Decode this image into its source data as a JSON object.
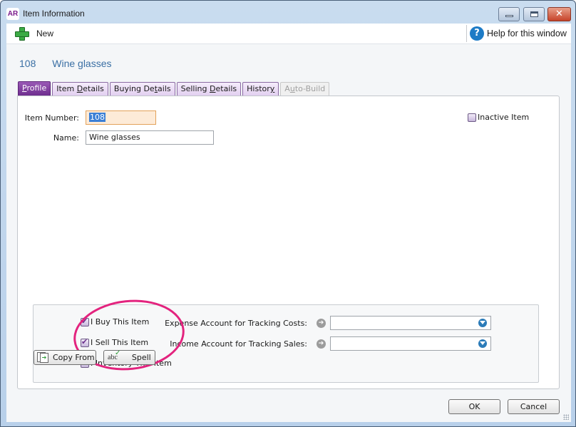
{
  "window": {
    "app_badge": "AR",
    "title": "Item Information"
  },
  "toolbar": {
    "new_label": "New",
    "help_label": "Help for this window"
  },
  "heading": {
    "item_number": "108",
    "item_name": "Wine glasses"
  },
  "tabs": [
    {
      "pre": "",
      "ul": "P",
      "post": "rofile",
      "active": true,
      "disabled": false
    },
    {
      "pre": "Item ",
      "ul": "D",
      "post": "etails",
      "active": false,
      "disabled": false
    },
    {
      "pre": "Buying De",
      "ul": "t",
      "post": "ails",
      "active": false,
      "disabled": false
    },
    {
      "pre": "Selling ",
      "ul": "D",
      "post": "etails",
      "active": false,
      "disabled": false
    },
    {
      "pre": "Histor",
      "ul": "y",
      "post": "",
      "active": false,
      "disabled": false
    },
    {
      "pre": "A",
      "ul": "u",
      "post": "to-Build",
      "active": false,
      "disabled": true
    }
  ],
  "profile": {
    "item_number_label": "Item Number:",
    "item_number_value": "108",
    "name_label": "Name:",
    "name_value": "Wine glasses",
    "inactive_label": "Inactive Item",
    "inactive_checked": false,
    "buy_label": "I Buy This Item",
    "buy_checked": true,
    "sell_label": "I Sell This Item",
    "sell_checked": true,
    "inventory_label": "I Inventory This Item",
    "inventory_checked": false,
    "expense_label": "Expense Account for Tracking Costs:",
    "expense_value": "",
    "income_label": "Income Account for Tracking Sales:",
    "income_value": ""
  },
  "buttons": {
    "copy_from": "Copy From",
    "spell": "Spell",
    "ok": "OK",
    "cancel": "Cancel"
  },
  "annotation": {
    "highlight_color": "#e3237e"
  }
}
